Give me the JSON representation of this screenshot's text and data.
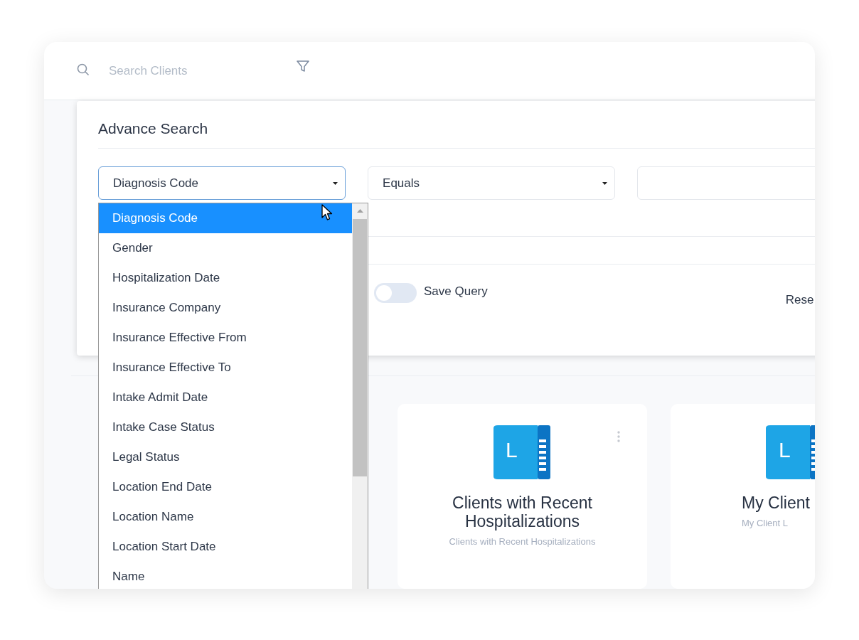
{
  "search": {
    "placeholder": "Search Clients"
  },
  "advance_search": {
    "title": "Advance Search",
    "field_select": {
      "value": "Diagnosis Code",
      "open": true
    },
    "operator_select": {
      "value": "Equals"
    },
    "save_query": {
      "label": "Save Query",
      "on": false
    },
    "reset_button": "Rese"
  },
  "field_options": [
    {
      "label": "Diagnosis Code",
      "selected": true
    },
    {
      "label": "Gender",
      "selected": false
    },
    {
      "label": "Hospitalization Date",
      "selected": false
    },
    {
      "label": "Insurance Company",
      "selected": false
    },
    {
      "label": "Insurance Effective From",
      "selected": false
    },
    {
      "label": "Insurance Effective To",
      "selected": false
    },
    {
      "label": "Intake Admit Date",
      "selected": false
    },
    {
      "label": "Intake Case Status",
      "selected": false
    },
    {
      "label": "Legal Status",
      "selected": false
    },
    {
      "label": "Location End Date",
      "selected": false
    },
    {
      "label": "Location Name",
      "selected": false
    },
    {
      "label": "Location Start Date",
      "selected": false
    },
    {
      "label": "Name",
      "selected": false
    }
  ],
  "lists": [
    {
      "icon_letter": "L",
      "title": "Clients with Recent Hospitalizations",
      "subtitle": "Clients with Recent Hospitalizations",
      "has_menu": true
    },
    {
      "icon_letter": "L",
      "title": "My Client",
      "subtitle": "My Client L",
      "has_menu": false
    }
  ]
}
